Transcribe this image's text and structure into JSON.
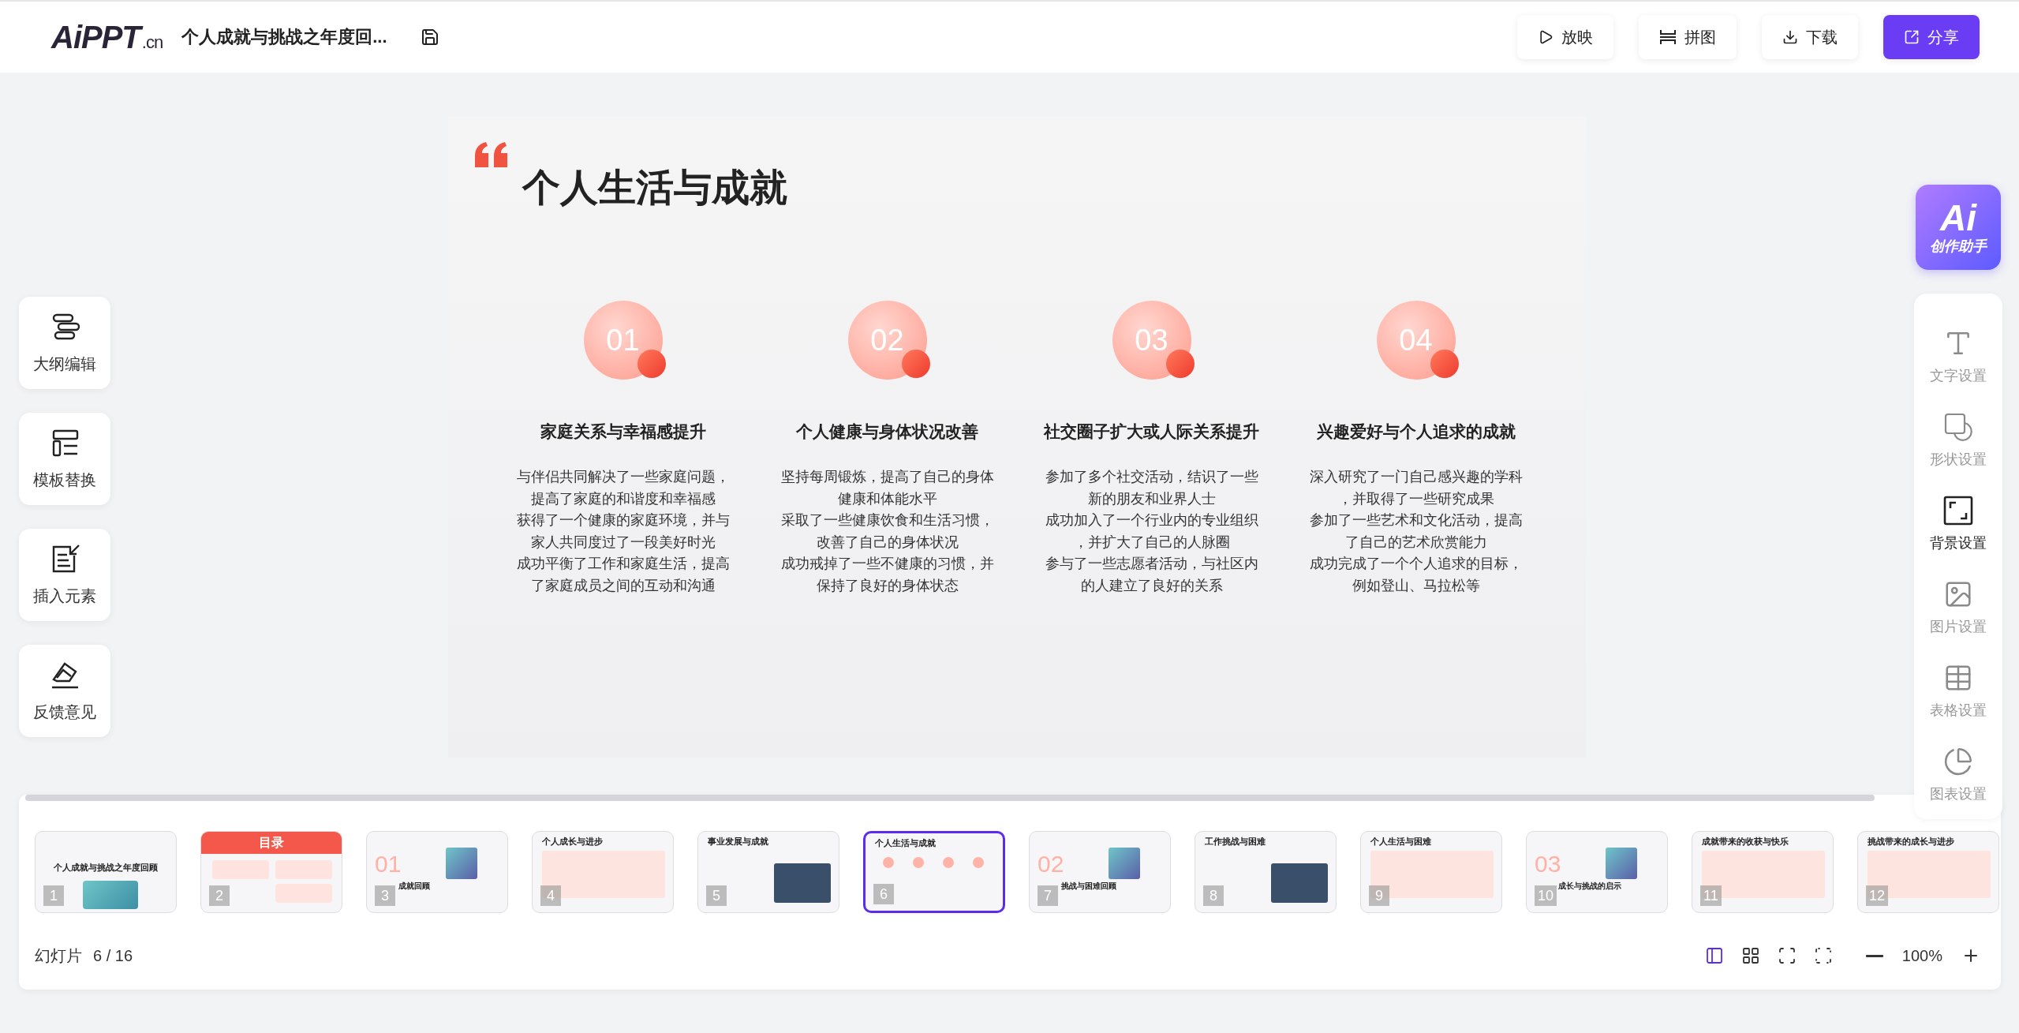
{
  "topbar": {
    "logo": {
      "main": "AiPPT",
      "suffix": ".cn"
    },
    "document_title": "个人成就与挑战之年度回...",
    "actions": [
      {
        "kind": "play",
        "label": "放映",
        "primary": false
      },
      {
        "kind": "collage",
        "label": "拼图",
        "primary": false
      },
      {
        "kind": "download",
        "label": "下载",
        "primary": false
      },
      {
        "kind": "share",
        "label": "分享",
        "primary": true
      }
    ]
  },
  "left_tools": [
    {
      "kind": "outline",
      "label": "大纲编辑"
    },
    {
      "kind": "template",
      "label": "模板替换"
    },
    {
      "kind": "insert",
      "label": "插入元素"
    },
    {
      "kind": "feedback",
      "label": "反馈意见"
    }
  ],
  "slide": {
    "title": "个人生活与成就",
    "items": [
      {
        "number": "01",
        "heading": "家庭关系与幸福感提升",
        "lines": [
          "与伴侣共同解决了一些家庭问题，",
          "提高了家庭的和谐度和幸福感",
          "获得了一个健康的家庭环境，并与",
          "家人共同度过了一段美好时光",
          "成功平衡了工作和家庭生活，提高",
          "了家庭成员之间的互动和沟通"
        ]
      },
      {
        "number": "02",
        "heading": "个人健康与身体状况改善",
        "lines": [
          "坚持每周锻炼，提高了自己的身体",
          "健康和体能水平",
          "采取了一些健康饮食和生活习惯，",
          "改善了自己的身体状况",
          "成功戒掉了一些不健康的习惯，并",
          "保持了良好的身体状态"
        ]
      },
      {
        "number": "03",
        "heading": "社交圈子扩大或人际关系提升",
        "lines": [
          "参加了多个社交活动，结识了一些",
          "新的朋友和业界人士",
          "成功加入了一个行业内的专业组织",
          "，并扩大了自己的人脉圈",
          "参与了一些志愿者活动，与社区内",
          "的人建立了良好的关系"
        ]
      },
      {
        "number": "04",
        "heading": "兴趣爱好与个人追求的成就",
        "lines": [
          "深入研究了一门自己感兴趣的学科",
          "，并取得了一些研究成果",
          "参加了一些艺术和文化活动，提高",
          "了自己的艺术欣赏能力",
          "成功完成了一个个人追求的目标，",
          "例如登山、马拉松等"
        ]
      }
    ]
  },
  "assistant": {
    "logo": "Ai",
    "label": "创作助手"
  },
  "settings": [
    {
      "kind": "text",
      "label": "文字设置",
      "selected": false
    },
    {
      "kind": "shape",
      "label": "形状设置",
      "selected": false
    },
    {
      "kind": "background",
      "label": "背景设置",
      "selected": true
    },
    {
      "kind": "image",
      "label": "图片设置",
      "selected": false
    },
    {
      "kind": "table",
      "label": "表格设置",
      "selected": false
    },
    {
      "kind": "chart",
      "label": "图表设置",
      "selected": false
    }
  ],
  "thumbnails": [
    {
      "number": "1",
      "kind": "cover",
      "title": "个人成就与挑战之年度回顾",
      "selected": false
    },
    {
      "number": "2",
      "kind": "toc",
      "title": "目录",
      "selected": false
    },
    {
      "number": "3",
      "kind": "section",
      "numeral": "01",
      "title": "成就回顾",
      "selected": false
    },
    {
      "number": "4",
      "kind": "list",
      "title": "个人成长与进步",
      "selected": false
    },
    {
      "number": "5",
      "kind": "photos",
      "title": "事业发展与成就",
      "selected": false
    },
    {
      "number": "6",
      "kind": "circles",
      "title": "个人生活与成就",
      "selected": true
    },
    {
      "number": "7",
      "kind": "section",
      "numeral": "02",
      "title": "挑战与困难回顾",
      "selected": false
    },
    {
      "number": "8",
      "kind": "photos",
      "title": "工作挑战与困难",
      "selected": false
    },
    {
      "number": "9",
      "kind": "list",
      "title": "个人生活与困难",
      "selected": false
    },
    {
      "number": "10",
      "kind": "section",
      "numeral": "03",
      "title": "成长与挑战的启示",
      "selected": false
    },
    {
      "number": "11",
      "kind": "list",
      "title": "成就带来的收获与快乐",
      "selected": false
    },
    {
      "number": "12",
      "kind": "list",
      "title": "挑战带来的成长与进步",
      "selected": false
    }
  ],
  "footer": {
    "label": "幻灯片",
    "counter": "6 / 16",
    "views": [
      {
        "kind": "editor",
        "selected": true
      },
      {
        "kind": "grid",
        "selected": false
      },
      {
        "kind": "fit",
        "selected": false
      },
      {
        "kind": "fullscreen",
        "selected": false
      }
    ],
    "zoom": "100%"
  }
}
